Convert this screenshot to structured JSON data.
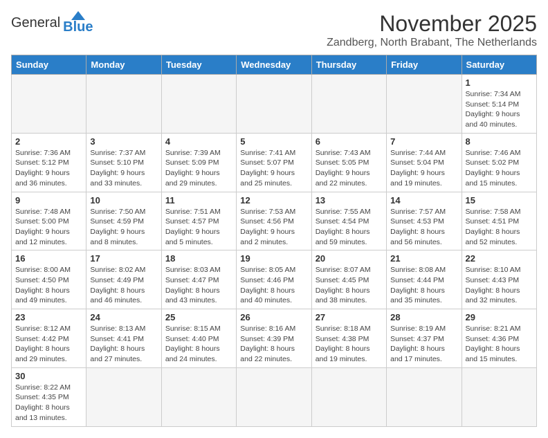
{
  "header": {
    "logo_general": "General",
    "logo_blue": "Blue",
    "month": "November 2025",
    "location": "Zandberg, North Brabant, The Netherlands"
  },
  "days_of_week": [
    "Sunday",
    "Monday",
    "Tuesday",
    "Wednesday",
    "Thursday",
    "Friday",
    "Saturday"
  ],
  "weeks": [
    [
      {
        "day": "",
        "info": ""
      },
      {
        "day": "",
        "info": ""
      },
      {
        "day": "",
        "info": ""
      },
      {
        "day": "",
        "info": ""
      },
      {
        "day": "",
        "info": ""
      },
      {
        "day": "",
        "info": ""
      },
      {
        "day": "1",
        "info": "Sunrise: 7:34 AM\nSunset: 5:14 PM\nDaylight: 9 hours and 40 minutes."
      }
    ],
    [
      {
        "day": "2",
        "info": "Sunrise: 7:36 AM\nSunset: 5:12 PM\nDaylight: 9 hours and 36 minutes."
      },
      {
        "day": "3",
        "info": "Sunrise: 7:37 AM\nSunset: 5:10 PM\nDaylight: 9 hours and 33 minutes."
      },
      {
        "day": "4",
        "info": "Sunrise: 7:39 AM\nSunset: 5:09 PM\nDaylight: 9 hours and 29 minutes."
      },
      {
        "day": "5",
        "info": "Sunrise: 7:41 AM\nSunset: 5:07 PM\nDaylight: 9 hours and 25 minutes."
      },
      {
        "day": "6",
        "info": "Sunrise: 7:43 AM\nSunset: 5:05 PM\nDaylight: 9 hours and 22 minutes."
      },
      {
        "day": "7",
        "info": "Sunrise: 7:44 AM\nSunset: 5:04 PM\nDaylight: 9 hours and 19 minutes."
      },
      {
        "day": "8",
        "info": "Sunrise: 7:46 AM\nSunset: 5:02 PM\nDaylight: 9 hours and 15 minutes."
      }
    ],
    [
      {
        "day": "9",
        "info": "Sunrise: 7:48 AM\nSunset: 5:00 PM\nDaylight: 9 hours and 12 minutes."
      },
      {
        "day": "10",
        "info": "Sunrise: 7:50 AM\nSunset: 4:59 PM\nDaylight: 9 hours and 8 minutes."
      },
      {
        "day": "11",
        "info": "Sunrise: 7:51 AM\nSunset: 4:57 PM\nDaylight: 9 hours and 5 minutes."
      },
      {
        "day": "12",
        "info": "Sunrise: 7:53 AM\nSunset: 4:56 PM\nDaylight: 9 hours and 2 minutes."
      },
      {
        "day": "13",
        "info": "Sunrise: 7:55 AM\nSunset: 4:54 PM\nDaylight: 8 hours and 59 minutes."
      },
      {
        "day": "14",
        "info": "Sunrise: 7:57 AM\nSunset: 4:53 PM\nDaylight: 8 hours and 56 minutes."
      },
      {
        "day": "15",
        "info": "Sunrise: 7:58 AM\nSunset: 4:51 PM\nDaylight: 8 hours and 52 minutes."
      }
    ],
    [
      {
        "day": "16",
        "info": "Sunrise: 8:00 AM\nSunset: 4:50 PM\nDaylight: 8 hours and 49 minutes."
      },
      {
        "day": "17",
        "info": "Sunrise: 8:02 AM\nSunset: 4:49 PM\nDaylight: 8 hours and 46 minutes."
      },
      {
        "day": "18",
        "info": "Sunrise: 8:03 AM\nSunset: 4:47 PM\nDaylight: 8 hours and 43 minutes."
      },
      {
        "day": "19",
        "info": "Sunrise: 8:05 AM\nSunset: 4:46 PM\nDaylight: 8 hours and 40 minutes."
      },
      {
        "day": "20",
        "info": "Sunrise: 8:07 AM\nSunset: 4:45 PM\nDaylight: 8 hours and 38 minutes."
      },
      {
        "day": "21",
        "info": "Sunrise: 8:08 AM\nSunset: 4:44 PM\nDaylight: 8 hours and 35 minutes."
      },
      {
        "day": "22",
        "info": "Sunrise: 8:10 AM\nSunset: 4:43 PM\nDaylight: 8 hours and 32 minutes."
      }
    ],
    [
      {
        "day": "23",
        "info": "Sunrise: 8:12 AM\nSunset: 4:42 PM\nDaylight: 8 hours and 29 minutes."
      },
      {
        "day": "24",
        "info": "Sunrise: 8:13 AM\nSunset: 4:41 PM\nDaylight: 8 hours and 27 minutes."
      },
      {
        "day": "25",
        "info": "Sunrise: 8:15 AM\nSunset: 4:40 PM\nDaylight: 8 hours and 24 minutes."
      },
      {
        "day": "26",
        "info": "Sunrise: 8:16 AM\nSunset: 4:39 PM\nDaylight: 8 hours and 22 minutes."
      },
      {
        "day": "27",
        "info": "Sunrise: 8:18 AM\nSunset: 4:38 PM\nDaylight: 8 hours and 19 minutes."
      },
      {
        "day": "28",
        "info": "Sunrise: 8:19 AM\nSunset: 4:37 PM\nDaylight: 8 hours and 17 minutes."
      },
      {
        "day": "29",
        "info": "Sunrise: 8:21 AM\nSunset: 4:36 PM\nDaylight: 8 hours and 15 minutes."
      }
    ],
    [
      {
        "day": "30",
        "info": "Sunrise: 8:22 AM\nSunset: 4:35 PM\nDaylight: 8 hours and 13 minutes."
      },
      {
        "day": "",
        "info": ""
      },
      {
        "day": "",
        "info": ""
      },
      {
        "day": "",
        "info": ""
      },
      {
        "day": "",
        "info": ""
      },
      {
        "day": "",
        "info": ""
      },
      {
        "day": "",
        "info": ""
      }
    ]
  ]
}
